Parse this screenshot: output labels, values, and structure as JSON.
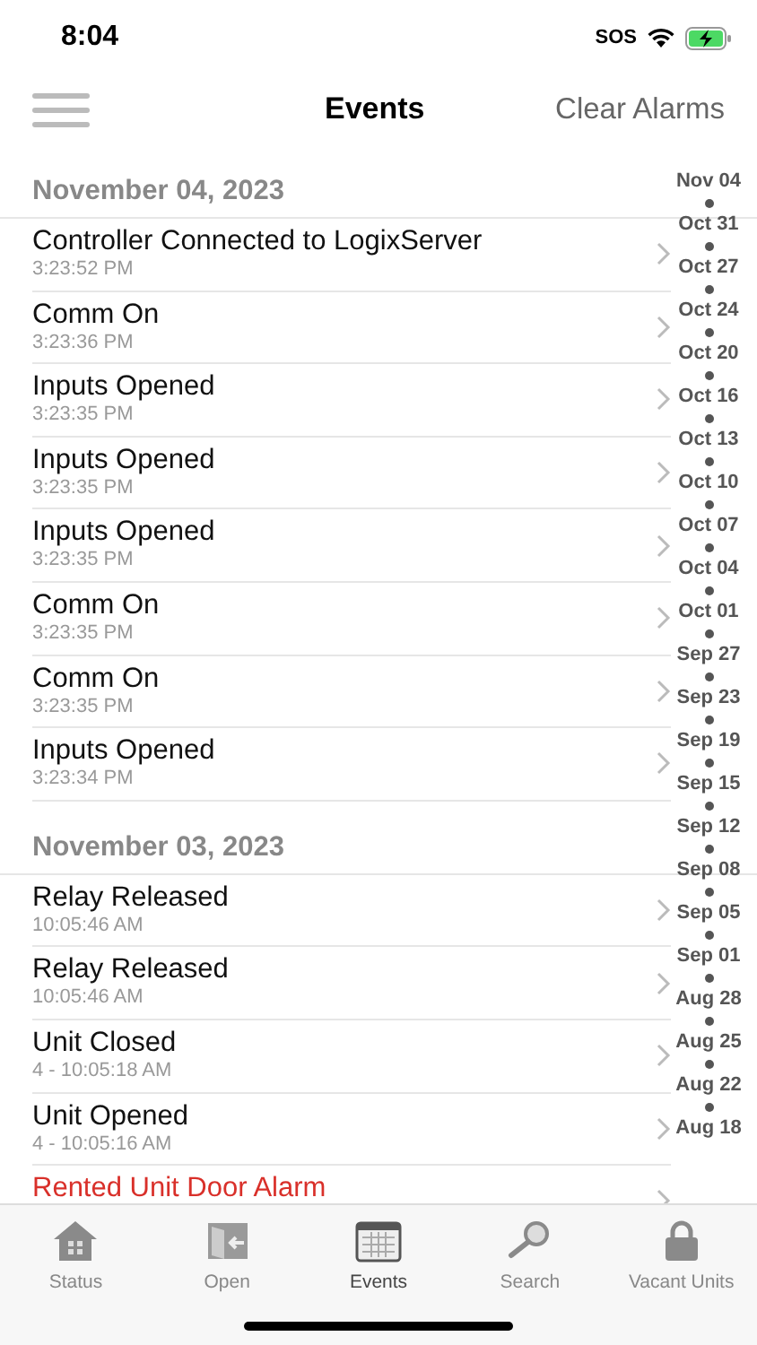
{
  "status_bar": {
    "time": "8:04",
    "carrier": "SOS"
  },
  "nav": {
    "title": "Events",
    "action": "Clear Alarms"
  },
  "sections": [
    {
      "date": "November 04, 2023",
      "events": [
        {
          "kind": "event",
          "title": "Controller Connected to LogixServer",
          "time": "3:23:52 PM"
        },
        {
          "kind": "event",
          "title": "Comm On",
          "time": "3:23:36 PM"
        },
        {
          "kind": "event",
          "title": "Inputs Opened",
          "time": "3:23:35 PM"
        },
        {
          "kind": "event",
          "title": "Inputs Opened",
          "time": "3:23:35 PM"
        },
        {
          "kind": "event",
          "title": "Inputs Opened",
          "time": "3:23:35 PM"
        },
        {
          "kind": "event",
          "title": "Comm On",
          "time": "3:23:35 PM"
        },
        {
          "kind": "event",
          "title": "Comm On",
          "time": "3:23:35 PM"
        },
        {
          "kind": "event",
          "title": "Inputs Opened",
          "time": "3:23:34 PM"
        }
      ]
    },
    {
      "date": "November 03, 2023",
      "events": [
        {
          "kind": "event",
          "title": "Relay Released",
          "time": "10:05:46 AM"
        },
        {
          "kind": "event",
          "title": "Relay Released",
          "time": "10:05:46 AM"
        },
        {
          "kind": "event",
          "title": "Unit Closed",
          "time": "4 - 10:05:18 AM"
        },
        {
          "kind": "event",
          "title": "Unit Opened",
          "time": "4 - 10:05:16 AM"
        },
        {
          "kind": "alarm",
          "title": "Rented Unit Door Alarm"
        }
      ]
    }
  ],
  "date_index": [
    "Nov 04",
    "Oct 31",
    "Oct 27",
    "Oct 24",
    "Oct 20",
    "Oct 16",
    "Oct 13",
    "Oct 10",
    "Oct 07",
    "Oct 04",
    "Oct 01",
    "Sep 27",
    "Sep 23",
    "Sep 19",
    "Sep 15",
    "Sep 12",
    "Sep 08",
    "Sep 05",
    "Sep 01",
    "Aug 28",
    "Aug 25",
    "Aug 22",
    "Aug 18"
  ],
  "tabs": [
    {
      "kind": "status",
      "label": "Status",
      "selected": false
    },
    {
      "kind": "open",
      "label": "Open",
      "selected": false
    },
    {
      "kind": "events",
      "label": "Events",
      "selected": true
    },
    {
      "kind": "search",
      "label": "Search",
      "selected": false
    },
    {
      "kind": "vacant",
      "label": "Vacant Units",
      "selected": false
    }
  ]
}
